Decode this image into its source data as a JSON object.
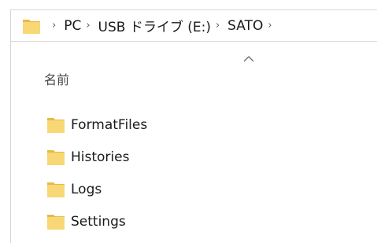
{
  "address_bar": {
    "folder_icon": "folder-icon",
    "breadcrumbs": [
      "PC",
      "USB ドライブ (E:)",
      "SATO"
    ],
    "separator_icon": "chevron-right-icon"
  },
  "column_header": {
    "name_label": "名前",
    "sort_icon": "sort-ascending-icon"
  },
  "files": [
    {
      "name": "FormatFiles",
      "icon": "folder-icon"
    },
    {
      "name": "Histories",
      "icon": "folder-icon"
    },
    {
      "name": "Logs",
      "icon": "folder-icon"
    },
    {
      "name": "Settings",
      "icon": "folder-icon"
    }
  ],
  "colors": {
    "folder_body": "#f8d775",
    "folder_tab": "#e8b84a",
    "border": "#d6d6d6"
  }
}
